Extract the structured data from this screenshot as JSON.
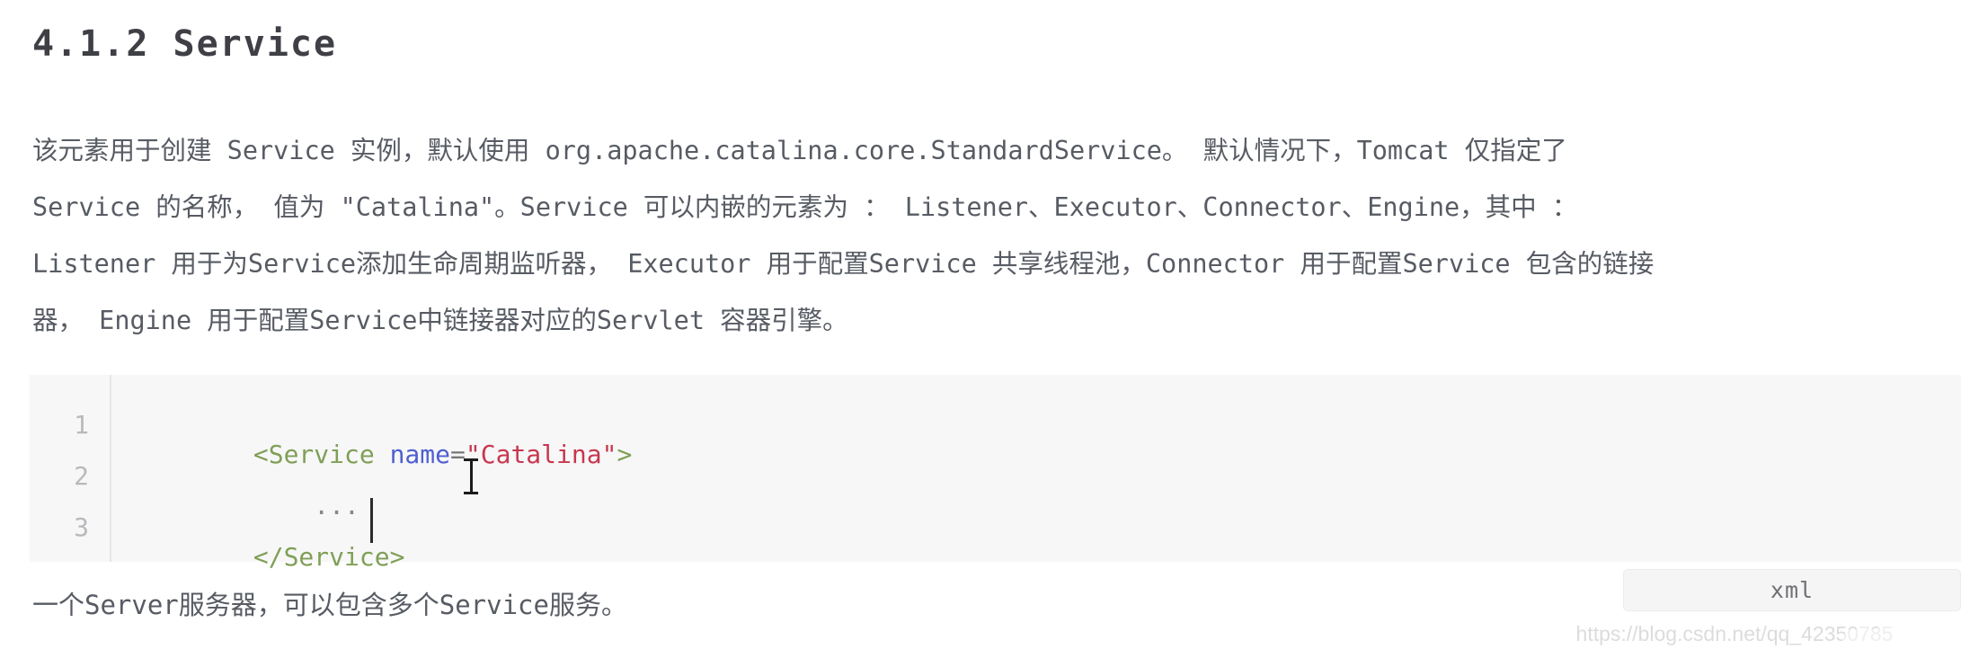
{
  "heading": {
    "text": "4.1.2 Service"
  },
  "paragraph": {
    "lines": [
      "该元素用于创建 Service 实例，默认使用 org.apache.catalina.core.StandardService。 默认情况下，Tomcat 仅指定了",
      "Service 的名称， 值为 \"Catalina\"。Service 可以内嵌的元素为 ： Listener、Executor、Connector、Engine，其中 ：",
      "Listener 用于为Service添加生命周期监听器， Executor 用于配置Service 共享线程池，Connector 用于配置Service 包含的链接",
      "器， Engine 用于配置Service中链接器对应的Servlet 容器引擎。"
    ]
  },
  "code_block": {
    "language_badge": "xml",
    "line_numbers": [
      "1",
      "2",
      "3"
    ],
    "lines": [
      {
        "number": "1",
        "tokens": [
          {
            "text": "<Service",
            "type": "tag"
          },
          {
            "text": " ",
            "type": "plain"
          },
          {
            "text": "name",
            "type": "attr"
          },
          {
            "text": "=",
            "type": "punct"
          },
          {
            "text": "\"Catalina\"",
            "type": "string"
          },
          {
            "text": ">",
            "type": "tag"
          }
        ]
      },
      {
        "number": "2",
        "tokens": [
          {
            "text": "    ...",
            "type": "plain"
          }
        ]
      },
      {
        "number": "3",
        "tokens": [
          {
            "text": "</Service>",
            "type": "tag"
          }
        ]
      }
    ],
    "colors": {
      "background": "#f7f7f8",
      "tag": "#7f9f56",
      "attribute": "#4f5fd0",
      "string": "#c7384f",
      "punctuation": "#777777",
      "line_number": "#b9b9bd"
    }
  },
  "closing": {
    "text": "一个Server服务器，可以包含多个Service服务。"
  },
  "watermark": {
    "url": "https://blog.csdn.net/qq_42350785"
  }
}
